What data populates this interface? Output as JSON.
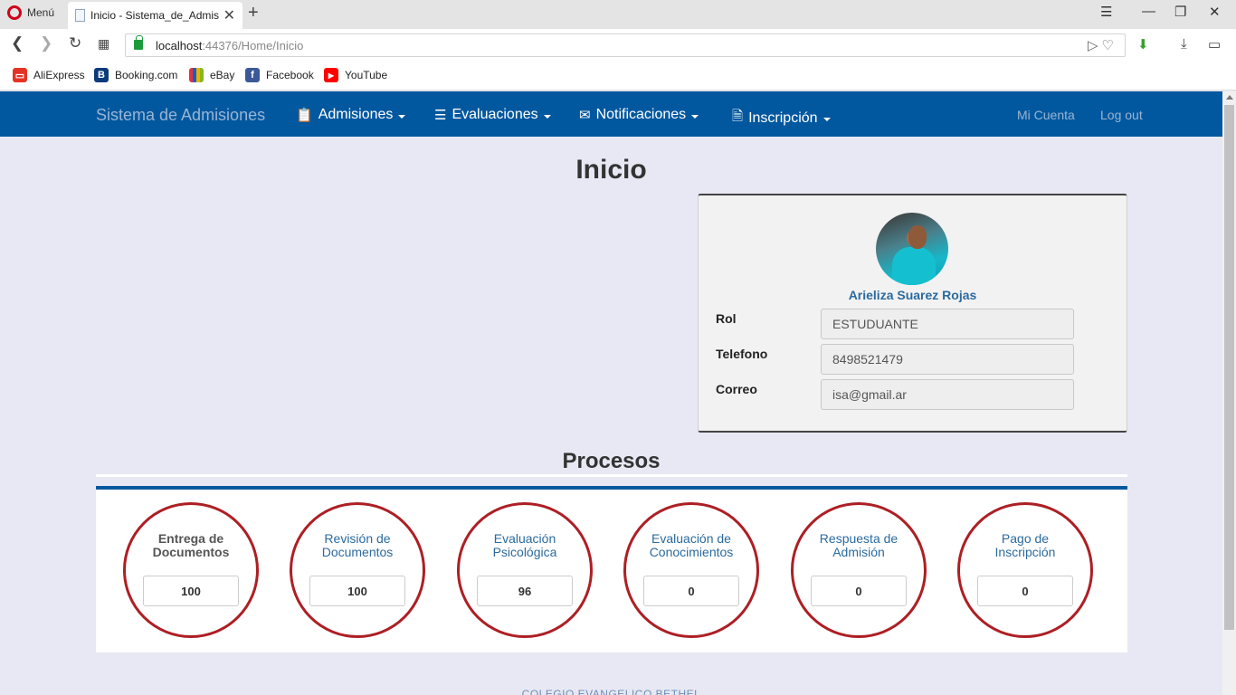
{
  "browser": {
    "menu_label": "Menú",
    "tab_title": "Inicio - Sistema_de_Admis",
    "url_host": "localhost",
    "url_rest": ":44376/Home/Inicio",
    "bookmarks": [
      "AliExpress",
      "Booking.com",
      "eBay",
      "Facebook",
      "YouTube"
    ]
  },
  "nav": {
    "brand": "Sistema de Admisiones",
    "items": [
      "Admisiones",
      "Evaluaciones",
      "Notificaciones",
      "Inscripción"
    ],
    "right": [
      "Mi Cuenta",
      "Log out"
    ]
  },
  "page": {
    "title": "Inicio",
    "section_title": "Procesos",
    "footer": "COLEGIO EVANGELICO BETHEL"
  },
  "profile": {
    "name": "Arieliza Suarez Rojas",
    "fields": [
      {
        "label": "Rol",
        "value": "ESTUDUANTE"
      },
      {
        "label": "Telefono",
        "value": "8498521479"
      },
      {
        "label": "Correo",
        "value": "isa@gmail.ar"
      }
    ]
  },
  "processes": [
    {
      "line1": "Entrega de",
      "line2": "Documentos",
      "value": "100"
    },
    {
      "line1": "Revisión de",
      "line2": "Documentos",
      "value": "100"
    },
    {
      "line1": "Evaluación",
      "line2": "Psicológica",
      "value": "96"
    },
    {
      "line1": "Evaluación de",
      "line2": "Conocimientos",
      "value": "0"
    },
    {
      "line1": "Respuesta de",
      "line2": "Admisión",
      "value": "0"
    },
    {
      "line1": "Pago de",
      "line2": "Inscripción",
      "value": "0"
    }
  ],
  "colors": {
    "navbar": "#02589f",
    "circle_border": "#ad1f24",
    "link": "#2b6a9e"
  }
}
